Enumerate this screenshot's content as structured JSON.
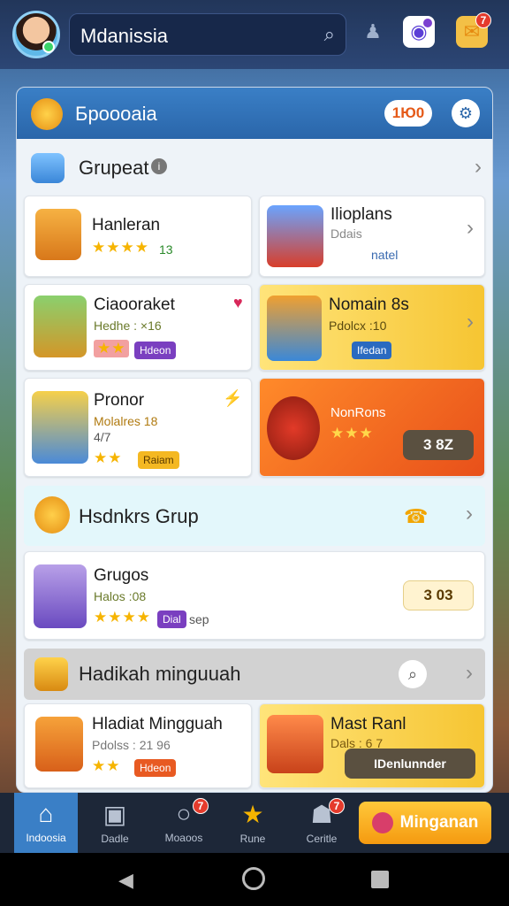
{
  "topbar": {
    "search_value": "Mdanissia",
    "search_icon": "magnifier",
    "icons": [
      "person-icon",
      "camera-icon",
      "mail-icon"
    ],
    "camera_badge": "",
    "mail_badge": "7"
  },
  "panel": {
    "title": "Бpoooaia",
    "chip": "1Ю0",
    "section1": {
      "title": "Grupeat",
      "cards": [
        {
          "title": "Hanleran",
          "sub": "",
          "stars": "★★★★",
          "extra": "13"
        },
        {
          "title": "Ilioplans",
          "sub": "Ddais",
          "meta": "natel"
        },
        {
          "title": "Ciaooraket",
          "sub": "Hedhe : ×16",
          "tag": "Hdeon"
        },
        {
          "title": "Nomain 8s",
          "sub": "Pdolcx :10",
          "tag": "Ifedan"
        },
        {
          "title": "Pronor",
          "sub": "Molalres 18",
          "sub2": "4/7",
          "tag": "Raiam"
        },
        {
          "title": "NonRons",
          "stars": "★★★",
          "button": "3 8Z"
        }
      ]
    },
    "section2": {
      "title": "Hsdnkrs Grup",
      "card": {
        "title": "Grugos",
        "sub": "Halos :08",
        "tag": "Dial",
        "tag_after": "sep",
        "button": "3 03"
      }
    },
    "section3": {
      "title": "Hadikah minguuah",
      "cards": [
        {
          "title": "Hladiat Mingguah",
          "sub": "Pdolss : 21 96",
          "tag": "Hdeon"
        },
        {
          "title": "Mast Ranl",
          "sub": "Dals : 6 7",
          "button": "IDenlunnder"
        }
      ]
    }
  },
  "bottomnav": {
    "items": [
      {
        "label": "Indoosia",
        "icon": "home-icon",
        "active": true
      },
      {
        "label": "Dadle",
        "icon": "box-icon"
      },
      {
        "label": "Moaoos",
        "icon": "chat-icon",
        "badge": "7"
      },
      {
        "label": "Rune",
        "icon": "star-icon"
      },
      {
        "label": "Ceritle",
        "icon": "store-icon",
        "badge": "7"
      }
    ],
    "cta": "Minganan"
  },
  "colors": {
    "accent": "#f5b400",
    "header": "#2a66aa",
    "cta": "#ffb21a"
  }
}
